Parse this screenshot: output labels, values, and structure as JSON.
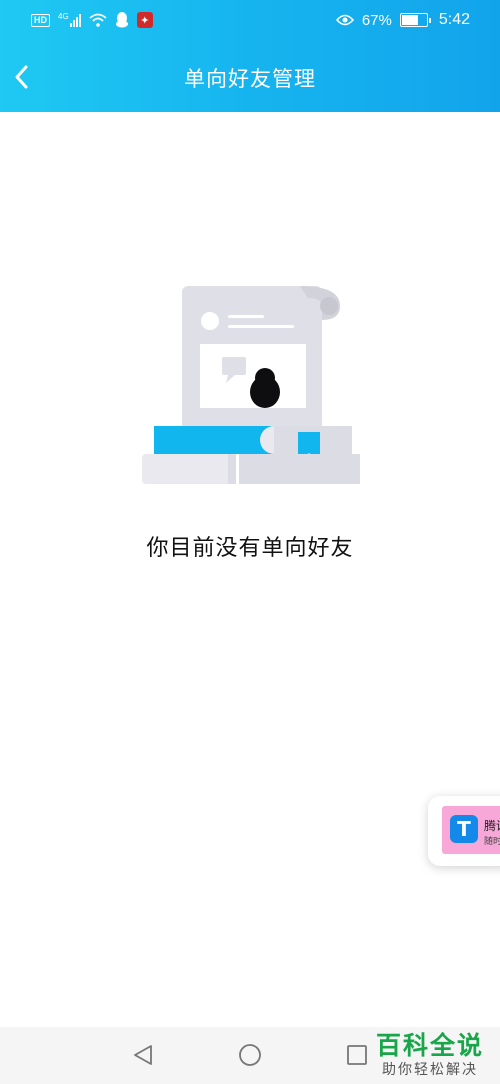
{
  "status_bar": {
    "hd": "HD",
    "network": "4G",
    "battery_percent": "67%",
    "battery_level": 0.67,
    "time": "5:42"
  },
  "header": {
    "title": "单向好友管理"
  },
  "empty_state": {
    "message": "你目前没有单向好友"
  },
  "floating_widget": {
    "title": "腾讯",
    "subtitle": "随时"
  },
  "watermark": {
    "title": "百科全说",
    "subtitle": "助你轻松解决"
  },
  "colors": {
    "header_gradient_start": "#1fc9f3",
    "header_gradient_end": "#12a4eb",
    "accent_blue": "#12b6ee",
    "brand_green": "#19a64a"
  },
  "icons": {
    "back": "chevron-left-icon",
    "nav_back": "triangle-back-icon",
    "nav_home": "circle-home-icon",
    "nav_recent": "square-recent-icon"
  }
}
